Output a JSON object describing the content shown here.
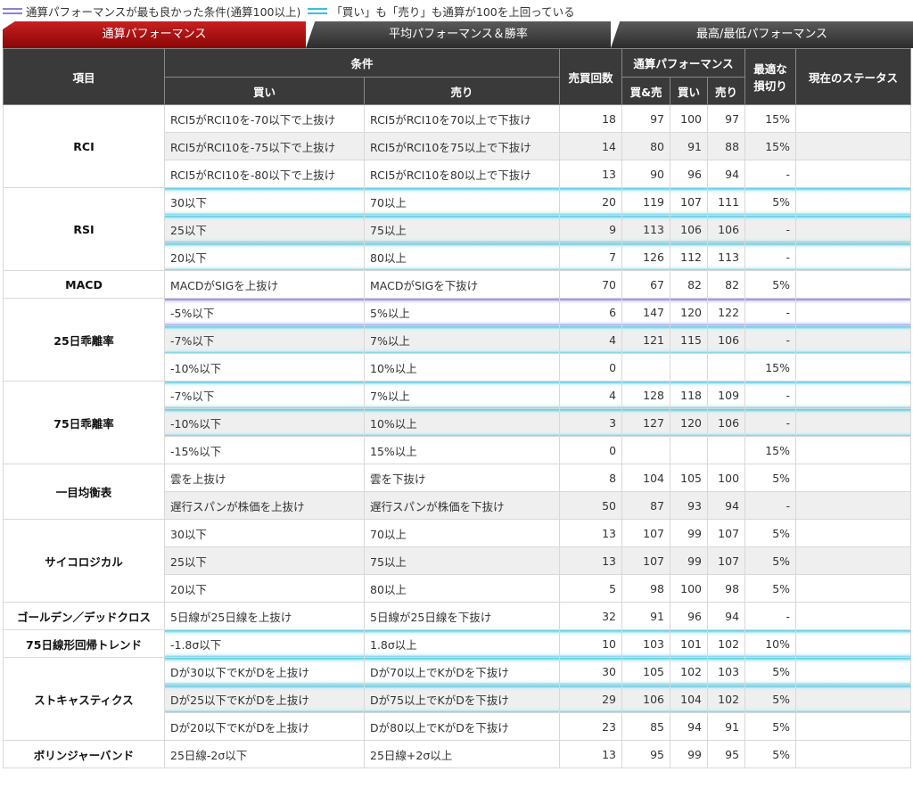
{
  "legend": {
    "purple": "通算パフォーマンスが最も良かった条件(通算100以上)",
    "cyan": "「買い」も「売り」も通算が100を上回っている"
  },
  "tabs": [
    "通算パフォーマンス",
    "平均パフォーマンス＆勝率",
    "最高/最低パフォーマンス"
  ],
  "header": {
    "item": "項目",
    "condition": "条件",
    "buy": "買い",
    "sell": "売り",
    "count": "売買回数",
    "perf": "通算パフォーマンス",
    "both": "買&売",
    "buy2": "買い",
    "sell2": "売り",
    "stop": "最適な損切り",
    "status": "現在のステータス"
  },
  "groups": [
    {
      "name": "RCI",
      "rows": [
        {
          "buy": "RCI5がRCI10を-70以下で上抜け",
          "sell": "RCI5がRCI10を70以上で下抜け",
          "count": "18",
          "both": "97",
          "b": "100",
          "s": "97",
          "stop": "15%",
          "hl": ""
        },
        {
          "buy": "RCI5がRCI10を-75以下で上抜け",
          "sell": "RCI5がRCI10を75以上で下抜け",
          "count": "14",
          "both": "80",
          "b": "91",
          "s": "88",
          "stop": "15%",
          "hl": ""
        },
        {
          "buy": "RCI5がRCI10を-80以下で上抜け",
          "sell": "RCI5がRCI10を80以上で下抜け",
          "count": "13",
          "both": "90",
          "b": "96",
          "s": "94",
          "stop": "-",
          "hl": ""
        }
      ]
    },
    {
      "name": "RSI",
      "rows": [
        {
          "buy": "30以下",
          "sell": "70以上",
          "count": "20",
          "both": "119",
          "b": "107",
          "s": "111",
          "stop": "5%",
          "hl": "cyan"
        },
        {
          "buy": "25以下",
          "sell": "75以上",
          "count": "9",
          "both": "113",
          "b": "106",
          "s": "106",
          "stop": "-",
          "hl": "cyan"
        },
        {
          "buy": "20以下",
          "sell": "80以上",
          "count": "7",
          "both": "126",
          "b": "112",
          "s": "113",
          "stop": "-",
          "hl": "cyan"
        }
      ]
    },
    {
      "name": "MACD",
      "rows": [
        {
          "buy": "MACDがSIGを上抜け",
          "sell": "MACDがSIGを下抜け",
          "count": "70",
          "both": "67",
          "b": "82",
          "s": "82",
          "stop": "5%",
          "hl": ""
        }
      ]
    },
    {
      "name": "25日乖離率",
      "rows": [
        {
          "buy": "-5%以下",
          "sell": "5%以上",
          "count": "6",
          "both": "147",
          "b": "120",
          "s": "122",
          "stop": "-",
          "hl": "purple"
        },
        {
          "buy": "-7%以下",
          "sell": "7%以上",
          "count": "4",
          "both": "121",
          "b": "115",
          "s": "106",
          "stop": "-",
          "hl": "cyan"
        },
        {
          "buy": "-10%以下",
          "sell": "10%以上",
          "count": "0",
          "both": "",
          "b": "",
          "s": "",
          "stop": "15%",
          "hl": ""
        }
      ]
    },
    {
      "name": "75日乖離率",
      "rows": [
        {
          "buy": "-7%以下",
          "sell": "7%以上",
          "count": "4",
          "both": "128",
          "b": "118",
          "s": "109",
          "stop": "-",
          "hl": "cyan"
        },
        {
          "buy": "-10%以下",
          "sell": "10%以上",
          "count": "3",
          "both": "127",
          "b": "120",
          "s": "106",
          "stop": "-",
          "hl": "cyan"
        },
        {
          "buy": "-15%以下",
          "sell": "15%以上",
          "count": "0",
          "both": "",
          "b": "",
          "s": "",
          "stop": "15%",
          "hl": ""
        }
      ]
    },
    {
      "name": "一目均衡表",
      "rows": [
        {
          "buy": "雲を上抜け",
          "sell": "雲を下抜け",
          "count": "8",
          "both": "104",
          "b": "105",
          "s": "100",
          "stop": "5%",
          "hl": ""
        },
        {
          "buy": "遅行スパンが株価を上抜け",
          "sell": "遅行スパンが株価を下抜け",
          "count": "50",
          "both": "87",
          "b": "93",
          "s": "94",
          "stop": "-",
          "hl": ""
        }
      ]
    },
    {
      "name": "サイコロジカル",
      "rows": [
        {
          "buy": "30以下",
          "sell": "70以上",
          "count": "13",
          "both": "107",
          "b": "99",
          "s": "107",
          "stop": "5%",
          "hl": ""
        },
        {
          "buy": "25以下",
          "sell": "75以上",
          "count": "13",
          "both": "107",
          "b": "99",
          "s": "107",
          "stop": "5%",
          "hl": ""
        },
        {
          "buy": "20以下",
          "sell": "80以上",
          "count": "5",
          "both": "98",
          "b": "100",
          "s": "98",
          "stop": "5%",
          "hl": ""
        }
      ]
    },
    {
      "name": "ゴールデン／デッドクロス",
      "rows": [
        {
          "buy": "5日線が25日線を上抜け",
          "sell": "5日線が25日線を下抜け",
          "count": "32",
          "both": "91",
          "b": "96",
          "s": "94",
          "stop": "-",
          "hl": ""
        }
      ]
    },
    {
      "name": "75日線形回帰トレンド",
      "rows": [
        {
          "buy": "-1.8σ以下",
          "sell": "1.8σ以上",
          "count": "10",
          "both": "103",
          "b": "101",
          "s": "102",
          "stop": "10%",
          "hl": "cyan"
        }
      ]
    },
    {
      "name": "ストキャスティクス",
      "rows": [
        {
          "buy": "Dが30以下でKがDを上抜け",
          "sell": "Dが70以上でKがDを下抜け",
          "count": "30",
          "both": "105",
          "b": "102",
          "s": "103",
          "stop": "5%",
          "hl": "cyan"
        },
        {
          "buy": "Dが25以下でKがDを上抜け",
          "sell": "Dが75以上でKがDを下抜け",
          "count": "29",
          "both": "106",
          "b": "104",
          "s": "102",
          "stop": "5%",
          "hl": "cyan"
        },
        {
          "buy": "Dが20以下でKがDを上抜け",
          "sell": "Dが80以上でKがDを下抜け",
          "count": "23",
          "both": "85",
          "b": "94",
          "s": "91",
          "stop": "5%",
          "hl": ""
        }
      ]
    },
    {
      "name": "ボリンジャーバンド",
      "rows": [
        {
          "buy": "25日線-2σ以下",
          "sell": "25日線+2σ以上",
          "count": "13",
          "both": "95",
          "b": "99",
          "s": "95",
          "stop": "5%",
          "hl": ""
        }
      ]
    }
  ]
}
